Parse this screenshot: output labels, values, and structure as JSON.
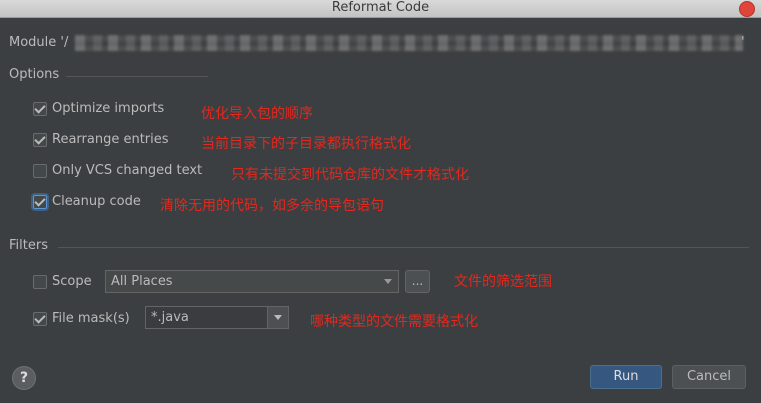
{
  "window": {
    "title": "Reformat Code"
  },
  "module": {
    "prefix": "Module '/",
    "suffix": "'"
  },
  "options": {
    "title": "Options",
    "items": [
      {
        "label": "Optimize imports",
        "checked": true,
        "annotation": "优化导入包的顺序"
      },
      {
        "label": "Rearrange entries",
        "checked": true,
        "annotation": "当前目录下的子目录都执行格式化"
      },
      {
        "label": "Only VCS changed text",
        "checked": false,
        "annotation": "只有未提交到代码仓库的文件才格式化"
      },
      {
        "label": "Cleanup code",
        "checked": true,
        "annotation": "清除无用的代码，如多余的导包语句"
      }
    ]
  },
  "filters": {
    "title": "Filters",
    "scope": {
      "label": "Scope",
      "checked": false,
      "value": "All Places",
      "browse_label": "...",
      "annotation": "文件的筛选范围"
    },
    "file_mask": {
      "label": "File mask(s)",
      "checked": true,
      "value": "*.java",
      "annotation": "哪种类型的文件需要格式化"
    }
  },
  "footer": {
    "help_label": "?",
    "run_label": "Run",
    "cancel_label": "Cancel"
  },
  "colors": {
    "background": "#3c3f41",
    "annotation": "#e3281e",
    "primary_button": "#365880",
    "focus": "#5d94d4"
  }
}
